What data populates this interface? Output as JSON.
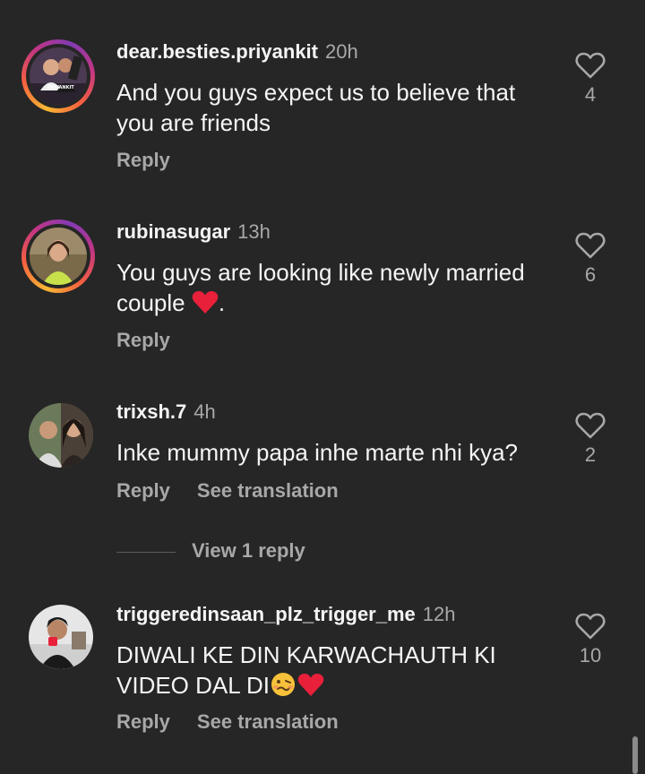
{
  "comments": [
    {
      "username": "dear.besties.priyankit",
      "time": "20h",
      "text": "And you guys expect us to believe that you are friends",
      "text_suffix": "",
      "actions": [
        "Reply"
      ],
      "likes": "4",
      "avatar_label": "PRIYANKIT"
    },
    {
      "username": "rubinasugar",
      "time": "13h",
      "text": "You guys are looking like newly married couple",
      "text_suffix": ".",
      "actions": [
        "Reply"
      ],
      "likes": "6"
    },
    {
      "username": "trixsh.7",
      "time": "4h",
      "text": "Inke mummy papa inhe marte nhi kya?",
      "text_suffix": "",
      "actions": [
        "Reply",
        "See translation"
      ],
      "likes": "2"
    },
    {
      "username": "triggeredinsaan_plz_trigger_me",
      "time": "12h",
      "text": "DIWALI KE DIN KARWACHAUTH KI VIDEO DAL DI",
      "text_suffix": "",
      "actions": [
        "Reply",
        "See translation"
      ],
      "likes": "10"
    }
  ],
  "view_replies": "View 1 reply",
  "icons": {
    "like": "heart-outline-icon",
    "heart_emoji": "red-heart-emoji",
    "face_emoji": "woozy-face-emoji"
  },
  "colors": {
    "background": "#262626",
    "primary_text": "#f5f5f5",
    "secondary_text": "#a8a8a8",
    "heart_red": "#e8203a"
  }
}
